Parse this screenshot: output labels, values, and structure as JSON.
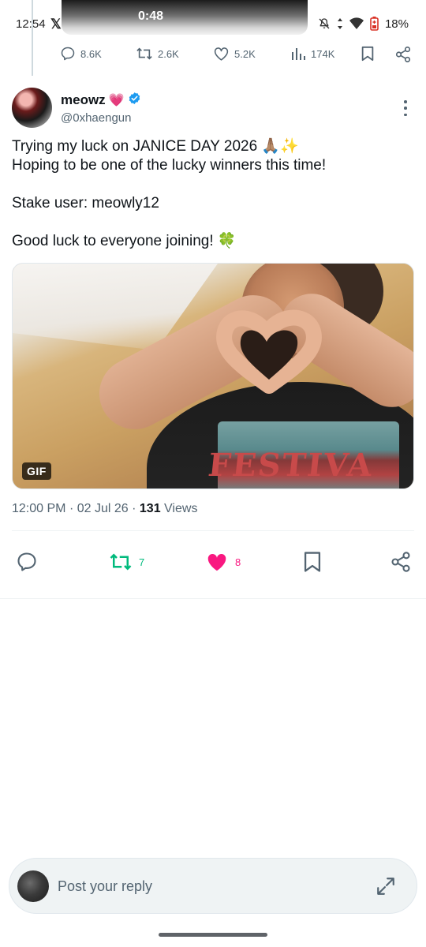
{
  "status_bar": {
    "time": "12:54",
    "app_icon": "x-logo-icon",
    "media_timer": "0:48",
    "battery": "18%",
    "icons": [
      "mute-icon",
      "data-arrows-icon",
      "wifi-icon",
      "battery-icon"
    ]
  },
  "parent_tweet_actions": {
    "replies": "8.6K",
    "reposts": "2.6K",
    "likes": "5.2K",
    "views": "174K"
  },
  "author": {
    "name": "meowz",
    "name_emoji": "💗",
    "handle": "@0xhaengun",
    "verified": true
  },
  "tweet": {
    "lines": [
      "Trying my luck on JANICE DAY 2026 🙏🏽✨",
      "Hoping to be one of the lucky winners this time!",
      "Stake user: meowly12",
      "Good luck to everyone joining! 🍀"
    ],
    "media": {
      "badge": "GIF",
      "shirt_text": "FESTIVA"
    },
    "time": "12:00 PM",
    "date": "02 Jul 26",
    "views_count": "131",
    "views_label": "Views"
  },
  "tweet_actions": {
    "reposts": "7",
    "likes": "8",
    "liked": true,
    "reposted": true
  },
  "colors": {
    "accent_blue": "#1d9bf0",
    "repost_green": "#00ba7c",
    "like_pink": "#f91880",
    "secondary_text": "#536471"
  },
  "reply": {
    "placeholder": "Post your reply"
  }
}
